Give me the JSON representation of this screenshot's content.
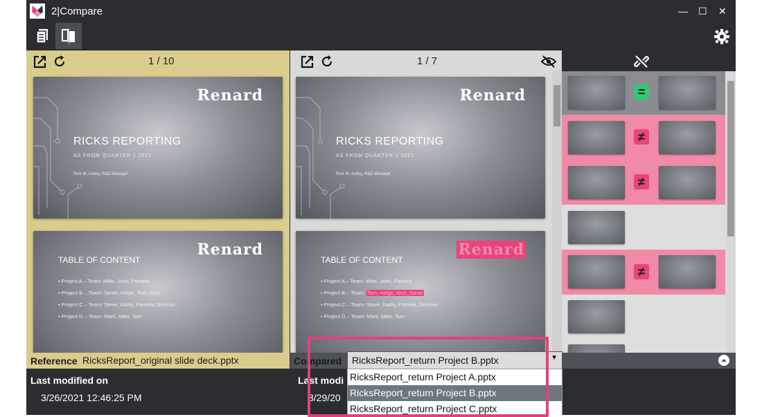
{
  "window": {
    "title": "2|Compare",
    "minimize": "—",
    "maximize": "☐",
    "close": "✕"
  },
  "toolbar": {
    "documents_icon": "documents-icon",
    "compare_icon": "compare-view-icon",
    "settings_icon": "gear-icon"
  },
  "reference": {
    "page_counter": "1 / 10",
    "label": "Reference",
    "filename": "RicksReport_original slide deck.pptx",
    "last_modified_label": "Last modified on",
    "last_modified_value": "3/26/2021 12:46:25 PM"
  },
  "compared": {
    "page_counter": "1 / 7",
    "label": "Compared",
    "last_modified_label": "Last modi",
    "last_modified_value": "3/29/20",
    "selected_file": "RicksReport_return Project B.pptx",
    "dropdown_options": [
      "RicksReport_return Project A.pptx",
      "RicksReport_return Project B.pptx",
      "RicksReport_return Project C.pptx"
    ]
  },
  "slides": {
    "brand": "Renard",
    "title_slide": {
      "title": "RICKS REPORTING",
      "subtitle": "AS FROM QUARTER 1 2021",
      "author": "Rick W. Astley, R&D Manager"
    },
    "toc_slide": {
      "title": "TABLE OF CONTENT",
      "items_reference": [
        "Project A – Team: Mike, John, Pamela",
        "Project B – Team: Sarah, Helge, Tom, Rick",
        "Project C – Team: Steve, Kathy, Pamela, Norman",
        "Project D – Team: Mark, Mike, Tom"
      ],
      "compared_item_b_prefix": "Project B – Team: ",
      "compared_item_b_changed": "Tom, Helge, Rick, Sarah"
    }
  },
  "comparison_rows": [
    {
      "status": "equal",
      "symbol": "="
    },
    {
      "status": "different",
      "symbol": "≠"
    },
    {
      "status": "different",
      "symbol": "≠"
    },
    {
      "status": "only-reference",
      "symbol": ""
    },
    {
      "status": "different",
      "symbol": "≠"
    },
    {
      "status": "only-reference",
      "symbol": ""
    }
  ],
  "colors": {
    "reference_bg": "#d9cd8c",
    "diff_pink": "#f08aa6",
    "equal_green": "#35c774",
    "highlight": "#e2417e"
  }
}
